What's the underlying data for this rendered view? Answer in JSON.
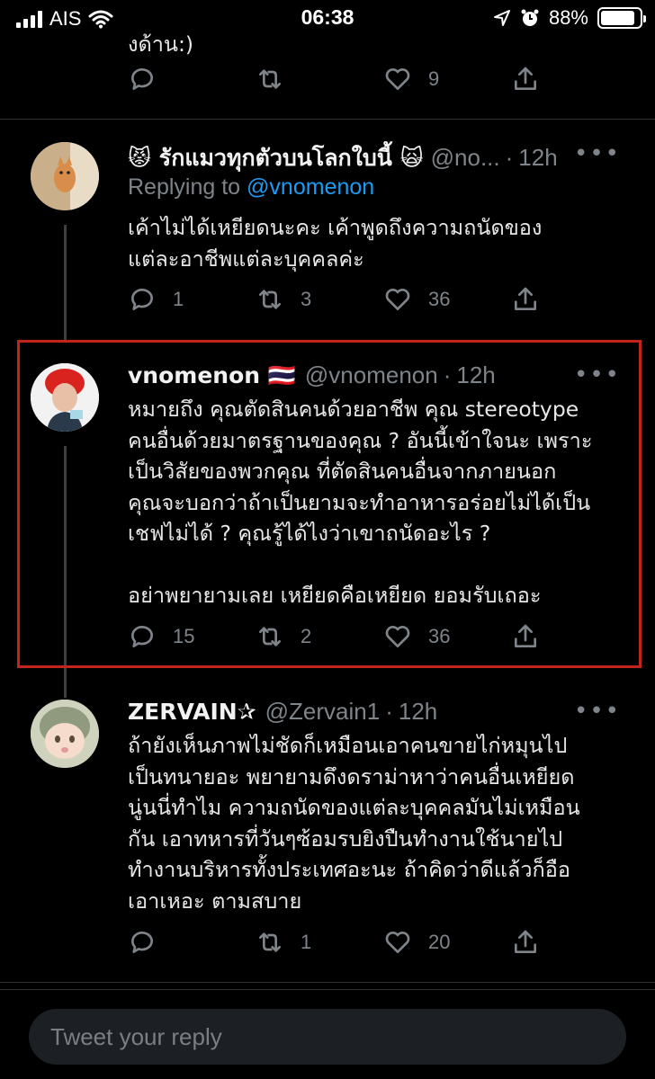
{
  "status_bar": {
    "carrier": "AIS",
    "time": "06:38",
    "battery_percent": "88%",
    "battery_level": 0.88
  },
  "previous_tweet": {
    "text_fragment": "งด้าน:)",
    "likes": "9"
  },
  "tweets": [
    {
      "name": "😾 รักแมวทุกตัวบนโลกใบนี้ 🙀",
      "handle": "@no...",
      "time": "12h",
      "replying_prefix": "Replying to",
      "replying_to": "@vnomenon",
      "text": "เค้าไม่ได้เหยียดนะคะ เค้าพูดถึงความถนัดของ\nแต่ละอาชีพแต่ละบุคคลค่ะ",
      "replies": "1",
      "retweets": "3",
      "likes": "36"
    },
    {
      "name": "vnomenon 🇹🇭",
      "handle": "@vnomenon",
      "time": "12h",
      "text": "หมายถึง คุณตัดสินคนด้วยอาชีพ คุณ stereotype\nคนอื่นด้วยมาตรฐานของคุณ ? อันนี้เข้าใจนะ เพราะ\nเป็นวิสัยของพวกคุณ ที่ตัดสินคนอื่นจากภายนอก\nคุณจะบอกว่าถ้าเป็นยามจะทำอาหารอร่อยไม่ได้เป็น\nเชฟไม่ได้ ? คุณรู้ได้ไงว่าเขาถนัดอะไร ?\n\nอย่าพยายามเลย เหยียดคือเหยียด ยอมรับเถอะ",
      "replies": "15",
      "retweets": "2",
      "likes": "36"
    },
    {
      "name": "ZERVAIN✰",
      "handle": "@Zervain1",
      "time": "12h",
      "text": "ถ้ายังเห็นภาพไม่ชัดก็เหมือนเอาคนขายไก่หมุนไป\nเป็นทนายอะ พยายามดึงดราม่าหาว่าคนอื่นเหยียด\nนู่นนี่ทำไม ความถนัดของแต่ละบุคคลมันไม่เหมือน\nกัน เอาทหารที่วันๆซ้อมรบยิงปืนทำงานใช้นายไป\nทำงานบริหารทั้งประเทศอะนะ ถ้าคิดว่าดีแล้วก็อือ\nเอาเหอะ ตามสบาย",
      "replies": "",
      "retweets": "1",
      "likes": "20"
    }
  ],
  "separator_dot": "·",
  "more_icon_glyph": "•••",
  "reply_bar": {
    "placeholder": "Tweet your reply"
  },
  "colors": {
    "background": "#000000",
    "muted": "#7e8489",
    "link": "#1d9bf0",
    "highlight_border": "#c0241b"
  }
}
